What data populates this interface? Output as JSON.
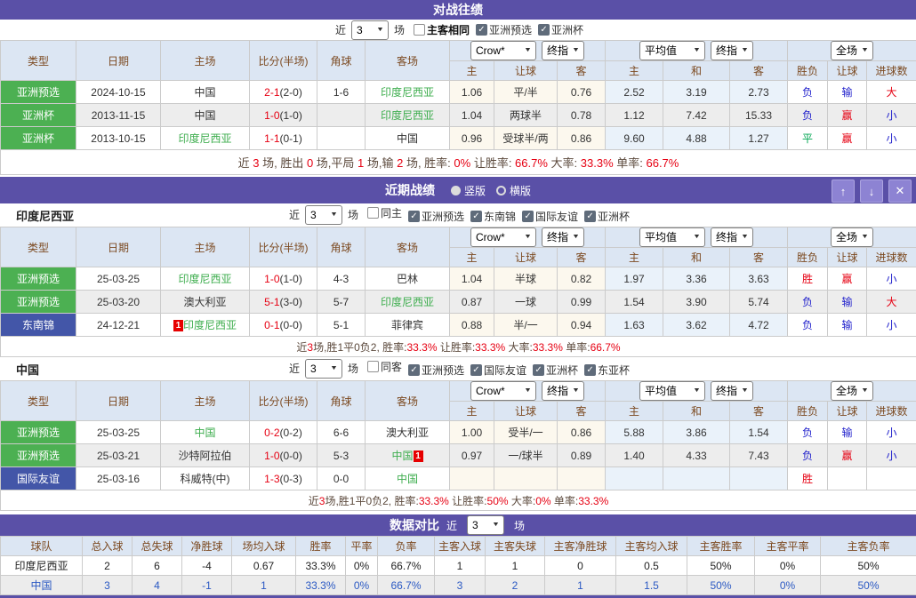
{
  "colors": {
    "section_bar_purple": "#5a50a7",
    "type_cell_green": "#4cb052",
    "type_cell_blue": "#4356a8",
    "team_green_text": "#3fae4f",
    "score_red": "#e60012",
    "result_blue": "#2222cc",
    "result_green": "#00a651",
    "header_bg": "#dce6f3",
    "header_text": "#7c4a21"
  },
  "match_columns": {
    "widths": [
      85,
      95,
      100,
      76,
      54,
      95,
      50,
      71,
      54,
      65,
      75,
      65,
      45,
      44,
      56
    ],
    "left": [
      "类型",
      "日期",
      "主场",
      "比分(半场)",
      "角球",
      "客场"
    ],
    "odds_dropdowns": [
      "Crow*",
      "终指"
    ],
    "avg_dropdowns": [
      "平均值",
      "终指"
    ],
    "result_dropdowns": [
      "全场"
    ],
    "sub": [
      "主",
      "让球",
      "客",
      "主",
      "和",
      "客",
      "胜负",
      "让球",
      "进球数"
    ]
  },
  "h2h": {
    "title": "对战往绩",
    "filter": {
      "near": "近",
      "rounds": "3",
      "games": "场",
      "checkboxes": [
        {
          "label": "主客相同",
          "checked": false,
          "bold": true
        },
        {
          "label": "亚洲预选",
          "checked": true,
          "bold": false
        },
        {
          "label": "亚洲杯",
          "checked": true,
          "bold": false
        }
      ]
    },
    "rows": [
      {
        "type": "亚洲预选",
        "type_style": "green",
        "date": "2024-10-15",
        "home": {
          "text": "中国",
          "green": false
        },
        "score": "2-1",
        "half": "(2-0)",
        "corner": "1-6",
        "away": {
          "text": "印度尼西亚",
          "green": true
        },
        "odds": [
          "1.06",
          "平/半",
          "0.76"
        ],
        "avg": [
          "2.52",
          "3.19",
          "2.73"
        ],
        "results": [
          {
            "t": "负",
            "c": "blue"
          },
          {
            "t": "输",
            "c": "blue"
          },
          {
            "t": "大",
            "c": "red"
          }
        ]
      },
      {
        "type": "亚洲杯",
        "type_style": "green",
        "date": "2013-11-15",
        "home": {
          "text": "中国",
          "green": false
        },
        "score": "1-0",
        "half": "(1-0)",
        "corner": "",
        "away": {
          "text": "印度尼西亚",
          "green": true
        },
        "odds": [
          "1.04",
          "两球半",
          "0.78"
        ],
        "avg": [
          "1.12",
          "7.42",
          "15.33"
        ],
        "results": [
          {
            "t": "负",
            "c": "blue"
          },
          {
            "t": "赢",
            "c": "red"
          },
          {
            "t": "小",
            "c": "blue"
          }
        ]
      },
      {
        "type": "亚洲杯",
        "type_style": "green",
        "date": "2013-10-15",
        "home": {
          "text": "印度尼西亚",
          "green": true
        },
        "score": "1-1",
        "half": "(0-1)",
        "corner": "",
        "away": {
          "text": "中国",
          "green": false
        },
        "odds": [
          "0.96",
          "受球半/两",
          "0.86"
        ],
        "avg": [
          "9.60",
          "4.88",
          "1.27"
        ],
        "results": [
          {
            "t": "平",
            "c": "green"
          },
          {
            "t": "赢",
            "c": "red"
          },
          {
            "t": "小",
            "c": "blue"
          }
        ]
      }
    ],
    "summary": [
      {
        "t": "近 ",
        "c": "dark"
      },
      {
        "t": "3",
        "c": "red"
      },
      {
        "t": " 场, 胜出 ",
        "c": "dark"
      },
      {
        "t": "0",
        "c": "red"
      },
      {
        "t": " 场,平局 ",
        "c": "dark"
      },
      {
        "t": "1",
        "c": "red"
      },
      {
        "t": " 场,输 ",
        "c": "dark"
      },
      {
        "t": "2",
        "c": "red"
      },
      {
        "t": " 场, 胜率: ",
        "c": "dark"
      },
      {
        "t": "0%",
        "c": "red"
      },
      {
        "t": " 让胜率: ",
        "c": "dark"
      },
      {
        "t": "66.7%",
        "c": "red"
      },
      {
        "t": " 大率: ",
        "c": "dark"
      },
      {
        "t": "33.3%",
        "c": "red"
      },
      {
        "t": " 单率: ",
        "c": "dark"
      },
      {
        "t": "66.7%",
        "c": "red"
      }
    ]
  },
  "recent": {
    "title": "近期战绩",
    "radios": [
      {
        "label": "竖版",
        "selected": true
      },
      {
        "label": "横版",
        "selected": false
      }
    ],
    "window_buttons": [
      {
        "name": "scroll-up",
        "glyph": "↑"
      },
      {
        "name": "scroll-down",
        "glyph": "↓"
      },
      {
        "name": "close",
        "glyph": "✕"
      }
    ],
    "teams": [
      {
        "name": "印度尼西亚",
        "filter": {
          "near": "近",
          "rounds": "3",
          "games": "场",
          "checkboxes": [
            {
              "label": "同主",
              "checked": false,
              "bold": false
            },
            {
              "label": "亚洲预选",
              "checked": true,
              "bold": false
            },
            {
              "label": "东南锦",
              "checked": true,
              "bold": false
            },
            {
              "label": "国际友谊",
              "checked": true,
              "bold": false
            },
            {
              "label": "亚洲杯",
              "checked": true,
              "bold": false
            }
          ]
        },
        "rows": [
          {
            "type": "亚洲预选",
            "type_style": "green",
            "date": "25-03-25",
            "home": {
              "text": "印度尼西亚",
              "green": true
            },
            "score": "1-0",
            "half": "(1-0)",
            "corner": "4-3",
            "away": {
              "text": "巴林",
              "green": false
            },
            "odds": [
              "1.04",
              "半球",
              "0.82"
            ],
            "avg": [
              "1.97",
              "3.36",
              "3.63"
            ],
            "results": [
              {
                "t": "胜",
                "c": "red"
              },
              {
                "t": "赢",
                "c": "red"
              },
              {
                "t": "小",
                "c": "blue"
              }
            ]
          },
          {
            "type": "亚洲预选",
            "type_style": "green",
            "date": "25-03-20",
            "home": {
              "text": "澳大利亚",
              "green": false
            },
            "score": "5-1",
            "half": "(3-0)",
            "corner": "5-7",
            "away": {
              "text": "印度尼西亚",
              "green": true
            },
            "odds": [
              "0.87",
              "一球",
              "0.99"
            ],
            "avg": [
              "1.54",
              "3.90",
              "5.74"
            ],
            "results": [
              {
                "t": "负",
                "c": "blue"
              },
              {
                "t": "输",
                "c": "blue"
              },
              {
                "t": "大",
                "c": "red"
              }
            ]
          },
          {
            "type": "东南锦",
            "type_style": "blue",
            "date": "24-12-21",
            "home": {
              "text": "印度尼西亚",
              "green": true,
              "badge": "1",
              "badge_pos": "before"
            },
            "score": "0-1",
            "half": "(0-0)",
            "corner": "5-1",
            "away": {
              "text": "菲律宾",
              "green": false
            },
            "odds": [
              "0.88",
              "半/一",
              "0.94"
            ],
            "avg": [
              "1.63",
              "3.62",
              "4.72"
            ],
            "results": [
              {
                "t": "负",
                "c": "blue"
              },
              {
                "t": "输",
                "c": "blue"
              },
              {
                "t": "小",
                "c": "blue"
              }
            ]
          }
        ],
        "summary": [
          {
            "t": "近",
            "c": "dark"
          },
          {
            "t": "3",
            "c": "red"
          },
          {
            "t": "场,胜1平0负2, 胜率:",
            "c": "dark"
          },
          {
            "t": "33.3%",
            "c": "red"
          },
          {
            "t": " 让胜率:",
            "c": "dark"
          },
          {
            "t": "33.3%",
            "c": "red"
          },
          {
            "t": " 大率:",
            "c": "dark"
          },
          {
            "t": "33.3%",
            "c": "red"
          },
          {
            "t": " 单率:",
            "c": "dark"
          },
          {
            "t": "66.7%",
            "c": "red"
          }
        ]
      },
      {
        "name": "中国",
        "filter": {
          "near": "近",
          "rounds": "3",
          "games": "场",
          "checkboxes": [
            {
              "label": "同客",
              "checked": false,
              "bold": false
            },
            {
              "label": "亚洲预选",
              "checked": true,
              "bold": false
            },
            {
              "label": "国际友谊",
              "checked": true,
              "bold": false
            },
            {
              "label": "亚洲杯",
              "checked": true,
              "bold": false
            },
            {
              "label": "东亚杯",
              "checked": true,
              "bold": false
            }
          ]
        },
        "rows": [
          {
            "type": "亚洲预选",
            "type_style": "green",
            "date": "25-03-25",
            "home": {
              "text": "中国",
              "green": true
            },
            "score": "0-2",
            "half": "(0-2)",
            "corner": "6-6",
            "away": {
              "text": "澳大利亚",
              "green": false
            },
            "odds": [
              "1.00",
              "受半/一",
              "0.86"
            ],
            "avg": [
              "5.88",
              "3.86",
              "1.54"
            ],
            "results": [
              {
                "t": "负",
                "c": "blue"
              },
              {
                "t": "输",
                "c": "blue"
              },
              {
                "t": "小",
                "c": "blue"
              }
            ]
          },
          {
            "type": "亚洲预选",
            "type_style": "green",
            "date": "25-03-21",
            "home": {
              "text": "沙特阿拉伯",
              "green": false
            },
            "score": "1-0",
            "half": "(0-0)",
            "corner": "5-3",
            "away": {
              "text": "中国",
              "green": true,
              "badge": "1",
              "badge_pos": "after"
            },
            "odds": [
              "0.97",
              "一/球半",
              "0.89"
            ],
            "avg": [
              "1.40",
              "4.33",
              "7.43"
            ],
            "results": [
              {
                "t": "负",
                "c": "blue"
              },
              {
                "t": "赢",
                "c": "red"
              },
              {
                "t": "小",
                "c": "blue"
              }
            ]
          },
          {
            "type": "国际友谊",
            "type_style": "blue",
            "date": "25-03-16",
            "home": {
              "text": "科威特(中)",
              "green": false
            },
            "score": "1-3",
            "half": "(0-3)",
            "corner": "0-0",
            "away": {
              "text": "中国",
              "green": true
            },
            "odds": [
              "",
              "",
              ""
            ],
            "avg": [
              "",
              "",
              ""
            ],
            "results": [
              {
                "t": "胜",
                "c": "red"
              },
              {
                "t": "",
                "c": "blue"
              },
              {
                "t": "",
                "c": "blue"
              }
            ]
          }
        ],
        "summary": [
          {
            "t": "近",
            "c": "dark"
          },
          {
            "t": "3",
            "c": "red"
          },
          {
            "t": "场,胜1平0负2, 胜率:",
            "c": "dark"
          },
          {
            "t": "33.3%",
            "c": "red"
          },
          {
            "t": " 让胜率:",
            "c": "dark"
          },
          {
            "t": "50%",
            "c": "red"
          },
          {
            "t": " 大率:",
            "c": "dark"
          },
          {
            "t": "0%",
            "c": "red"
          },
          {
            "t": " 单率:",
            "c": "dark"
          },
          {
            "t": "33.3%",
            "c": "red"
          }
        ]
      }
    ]
  },
  "comparison": {
    "title": "数据对比",
    "near": "近",
    "rounds": "3",
    "games": "场",
    "widths": [
      92,
      56,
      56,
      56,
      72,
      56,
      36,
      64,
      57,
      67,
      80,
      80,
      76,
      74,
      108
    ],
    "headers": [
      "球队",
      "总入球",
      "总失球",
      "净胜球",
      "场均入球",
      "胜率",
      "平率",
      "负率",
      "主客入球",
      "主客失球",
      "主客净胜球",
      "主客均入球",
      "主客胜率",
      "主客平率",
      "主客负率"
    ],
    "rows": [
      {
        "style": "plain",
        "cells": [
          "印度尼西亚",
          "2",
          "6",
          "-4",
          "0.67",
          "33.3%",
          "0%",
          "66.7%",
          "1",
          "1",
          "0",
          "0.5",
          "50%",
          "0%",
          "50%"
        ]
      },
      {
        "style": "blue",
        "cells": [
          "中国",
          "3",
          "4",
          "-1",
          "1",
          "33.3%",
          "0%",
          "66.7%",
          "3",
          "2",
          "1",
          "1.5",
          "50%",
          "0%",
          "50%"
        ]
      }
    ]
  }
}
